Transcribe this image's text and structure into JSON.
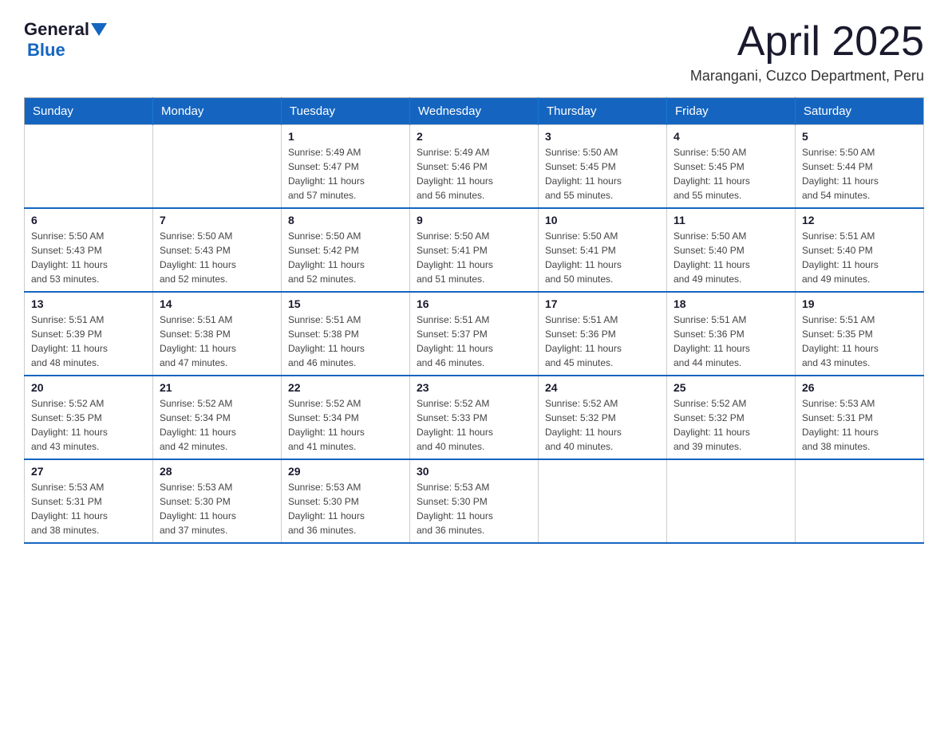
{
  "logo": {
    "general": "General",
    "blue": "Blue"
  },
  "title": "April 2025",
  "subtitle": "Marangani, Cuzco Department, Peru",
  "days_of_week": [
    "Sunday",
    "Monday",
    "Tuesday",
    "Wednesday",
    "Thursday",
    "Friday",
    "Saturday"
  ],
  "weeks": [
    [
      {
        "day": "",
        "info": ""
      },
      {
        "day": "",
        "info": ""
      },
      {
        "day": "1",
        "info": "Sunrise: 5:49 AM\nSunset: 5:47 PM\nDaylight: 11 hours\nand 57 minutes."
      },
      {
        "day": "2",
        "info": "Sunrise: 5:49 AM\nSunset: 5:46 PM\nDaylight: 11 hours\nand 56 minutes."
      },
      {
        "day": "3",
        "info": "Sunrise: 5:50 AM\nSunset: 5:45 PM\nDaylight: 11 hours\nand 55 minutes."
      },
      {
        "day": "4",
        "info": "Sunrise: 5:50 AM\nSunset: 5:45 PM\nDaylight: 11 hours\nand 55 minutes."
      },
      {
        "day": "5",
        "info": "Sunrise: 5:50 AM\nSunset: 5:44 PM\nDaylight: 11 hours\nand 54 minutes."
      }
    ],
    [
      {
        "day": "6",
        "info": "Sunrise: 5:50 AM\nSunset: 5:43 PM\nDaylight: 11 hours\nand 53 minutes."
      },
      {
        "day": "7",
        "info": "Sunrise: 5:50 AM\nSunset: 5:43 PM\nDaylight: 11 hours\nand 52 minutes."
      },
      {
        "day": "8",
        "info": "Sunrise: 5:50 AM\nSunset: 5:42 PM\nDaylight: 11 hours\nand 52 minutes."
      },
      {
        "day": "9",
        "info": "Sunrise: 5:50 AM\nSunset: 5:41 PM\nDaylight: 11 hours\nand 51 minutes."
      },
      {
        "day": "10",
        "info": "Sunrise: 5:50 AM\nSunset: 5:41 PM\nDaylight: 11 hours\nand 50 minutes."
      },
      {
        "day": "11",
        "info": "Sunrise: 5:50 AM\nSunset: 5:40 PM\nDaylight: 11 hours\nand 49 minutes."
      },
      {
        "day": "12",
        "info": "Sunrise: 5:51 AM\nSunset: 5:40 PM\nDaylight: 11 hours\nand 49 minutes."
      }
    ],
    [
      {
        "day": "13",
        "info": "Sunrise: 5:51 AM\nSunset: 5:39 PM\nDaylight: 11 hours\nand 48 minutes."
      },
      {
        "day": "14",
        "info": "Sunrise: 5:51 AM\nSunset: 5:38 PM\nDaylight: 11 hours\nand 47 minutes."
      },
      {
        "day": "15",
        "info": "Sunrise: 5:51 AM\nSunset: 5:38 PM\nDaylight: 11 hours\nand 46 minutes."
      },
      {
        "day": "16",
        "info": "Sunrise: 5:51 AM\nSunset: 5:37 PM\nDaylight: 11 hours\nand 46 minutes."
      },
      {
        "day": "17",
        "info": "Sunrise: 5:51 AM\nSunset: 5:36 PM\nDaylight: 11 hours\nand 45 minutes."
      },
      {
        "day": "18",
        "info": "Sunrise: 5:51 AM\nSunset: 5:36 PM\nDaylight: 11 hours\nand 44 minutes."
      },
      {
        "day": "19",
        "info": "Sunrise: 5:51 AM\nSunset: 5:35 PM\nDaylight: 11 hours\nand 43 minutes."
      }
    ],
    [
      {
        "day": "20",
        "info": "Sunrise: 5:52 AM\nSunset: 5:35 PM\nDaylight: 11 hours\nand 43 minutes."
      },
      {
        "day": "21",
        "info": "Sunrise: 5:52 AM\nSunset: 5:34 PM\nDaylight: 11 hours\nand 42 minutes."
      },
      {
        "day": "22",
        "info": "Sunrise: 5:52 AM\nSunset: 5:34 PM\nDaylight: 11 hours\nand 41 minutes."
      },
      {
        "day": "23",
        "info": "Sunrise: 5:52 AM\nSunset: 5:33 PM\nDaylight: 11 hours\nand 40 minutes."
      },
      {
        "day": "24",
        "info": "Sunrise: 5:52 AM\nSunset: 5:32 PM\nDaylight: 11 hours\nand 40 minutes."
      },
      {
        "day": "25",
        "info": "Sunrise: 5:52 AM\nSunset: 5:32 PM\nDaylight: 11 hours\nand 39 minutes."
      },
      {
        "day": "26",
        "info": "Sunrise: 5:53 AM\nSunset: 5:31 PM\nDaylight: 11 hours\nand 38 minutes."
      }
    ],
    [
      {
        "day": "27",
        "info": "Sunrise: 5:53 AM\nSunset: 5:31 PM\nDaylight: 11 hours\nand 38 minutes."
      },
      {
        "day": "28",
        "info": "Sunrise: 5:53 AM\nSunset: 5:30 PM\nDaylight: 11 hours\nand 37 minutes."
      },
      {
        "day": "29",
        "info": "Sunrise: 5:53 AM\nSunset: 5:30 PM\nDaylight: 11 hours\nand 36 minutes."
      },
      {
        "day": "30",
        "info": "Sunrise: 5:53 AM\nSunset: 5:30 PM\nDaylight: 11 hours\nand 36 minutes."
      },
      {
        "day": "",
        "info": ""
      },
      {
        "day": "",
        "info": ""
      },
      {
        "day": "",
        "info": ""
      }
    ]
  ]
}
